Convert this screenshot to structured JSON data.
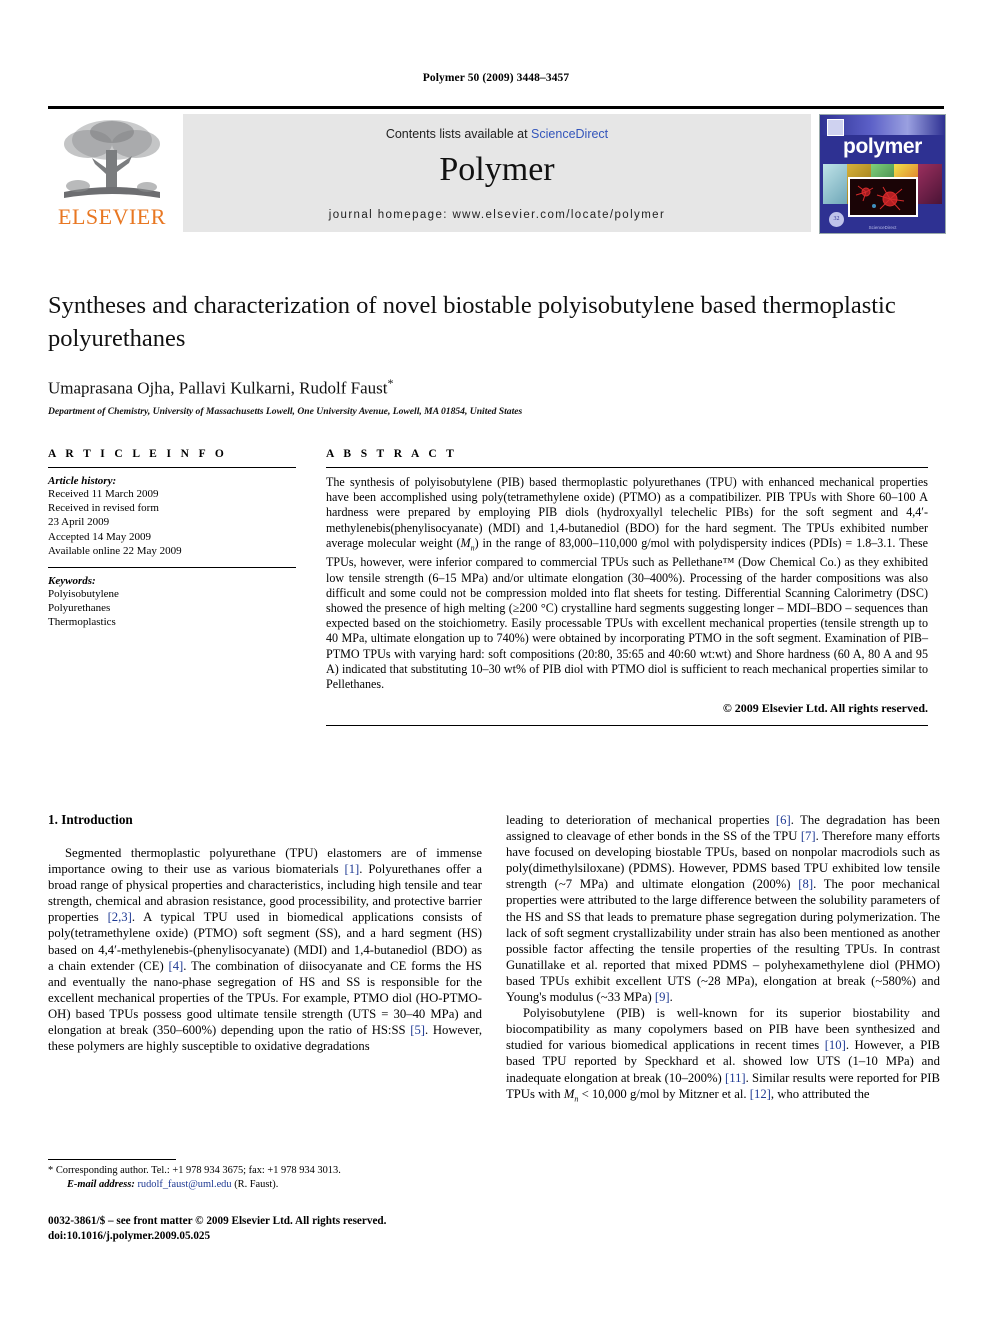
{
  "running_head": "Polymer 50 (2009) 3448–3457",
  "banner": {
    "publisher_name": "ELSEVIER",
    "contents_prefix": "Contents lists available at ",
    "contents_link": "ScienceDirect",
    "journal_name": "Polymer",
    "homepage": "journal homepage: www.elsevier.com/locate/polymer",
    "cover_title": "polymer",
    "cover_badge": "32"
  },
  "article": {
    "title": "Syntheses and characterization of novel biostable polyisobutylene based thermoplastic polyurethanes",
    "authors": "Umaprasana Ojha, Pallavi Kulkarni, Rudolf Faust",
    "corresponding_marker": "*",
    "affiliation": "Department of Chemistry, University of Massachusetts Lowell, One University Avenue, Lowell, MA 01854, United States"
  },
  "article_info": {
    "heading": "A R T I C L E   I N F O",
    "history_label": "Article history:",
    "history": [
      "Received 11 March 2009",
      "Received in revised form",
      "23 April 2009",
      "Accepted 14 May 2009",
      "Available online 22 May 2009"
    ],
    "keywords_label": "Keywords:",
    "keywords": [
      "Polyisobutylene",
      "Polyurethanes",
      "Thermoplastics"
    ]
  },
  "abstract": {
    "heading": "A B S T R A C T",
    "text": "The synthesis of polyisobutylene (PIB) based thermoplastic polyurethanes (TPU) with enhanced mechanical properties have been accomplished using poly(tetramethylene oxide) (PTMO) as a compatibilizer. PIB TPUs with Shore 60–100 A hardness were prepared by employing PIB diols (hydroxyallyl telechelic PIBs) for the soft segment and 4,4′-methylenebis(phenylisocyanate) (MDI) and 1,4-butanediol (BDO) for the hard segment. The TPUs exhibited number average molecular weight (Mn) in the range of 83,000–110,000 g/mol with polydispersity indices (PDIs) = 1.8–3.1. These TPUs, however, were inferior compared to commercial TPUs such as Pellethane™ (Dow Chemical Co.) as they exhibited low tensile strength (6–15 MPa) and/or ultimate elongation (30–400%). Processing of the harder compositions was also difficult and some could not be compression molded into flat sheets for testing. Differential Scanning Calorimetry (DSC) showed the presence of high melting (≥200 °C) crystalline hard segments suggesting longer – MDI–BDO – sequences than expected based on the stoichiometry. Easily processable TPUs with excellent mechanical properties (tensile strength up to 40 MPa, ultimate elongation up to 740%) were obtained by incorporating PTMO in the soft segment. Examination of PIB–PTMO TPUs with varying hard: soft compositions (20:80, 35:65 and 40:60 wt:wt) and Shore hardness (60 A, 80 A and 95 A) indicated that substituting 10–30 wt% of PIB diol with PTMO diol is sufficient to reach mechanical properties similar to Pellethanes.",
    "copyright": "© 2009 Elsevier Ltd. All rights reserved."
  },
  "introduction": {
    "heading": "1. Introduction",
    "left_paragraph": "Segmented thermoplastic polyurethane (TPU) elastomers are of immense importance owing to their use as various biomaterials [1]. Polyurethanes offer a broad range of physical properties and characteristics, including high tensile and tear strength, chemical and abrasion resistance, good processibility, and protective barrier properties [2,3]. A typical TPU used in biomedical applications consists of poly(tetramethylene oxide) (PTMO) soft segment (SS), and a hard segment (HS) based on 4,4′-methylenebis-(phenylisocyanate) (MDI) and 1,4-butanediol (BDO) as a chain extender (CE) [4]. The combination of diisocyanate and CE forms the HS and eventually the nano-phase segregation of HS and SS is responsible for the excellent mechanical properties of the TPUs. For example, PTMO diol (HO-PTMO-OH) based TPUs possess good ultimate tensile strength (UTS = 30–40 MPa) and elongation at break (350–600%) depending upon the ratio of HS:SS [5]. However, these polymers are highly susceptible to oxidative degradations",
    "right_paragraph_1": "leading to deterioration of mechanical properties [6]. The degradation has been assigned to cleavage of ether bonds in the SS of the TPU [7]. Therefore many efforts have focused on developing biostable TPUs, based on nonpolar macrodiols such as poly(dimethylsiloxane) (PDMS). However, PDMS based TPU exhibited low tensile strength (~7 MPa) and ultimate elongation (200%) [8]. The poor mechanical properties were attributed to the large difference between the solubility parameters of the HS and SS that leads to premature phase segregation during polymerization. The lack of soft segment crystallizability under strain has also been mentioned as another possible factor affecting the tensile properties of the resulting TPUs. In contrast Gunatillake et al. reported that mixed PDMS – polyhexamethylene diol (PHMO) based TPUs exhibit excellent UTS (~28 MPa), elongation at break (~580%) and Young's modulus (~33 MPa) [9].",
    "right_paragraph_2": "Polyisobutylene (PIB) is well-known for its superior biostability and biocompatibility as many copolymers based on PIB have been synthesized and studied for various biomedical applications in recent times [10]. However, a PIB based TPU reported by Speckhard et al. showed low UTS (1–10 MPa) and inadequate elongation at break (10–200%) [11]. Similar results were reported for PIB TPUs with Mn < 10,000 g/mol by Mitzner et al. [12], who attributed the"
  },
  "footnote": {
    "marker": "*",
    "corresponding": "Corresponding author. Tel.: +1 978 934 3675; fax: +1 978 934 3013.",
    "email_label": "E-mail address:",
    "email": "rudolf_faust@uml.edu",
    "email_suffix": "(R. Faust)."
  },
  "imprint": {
    "line1": "0032-3861/$ – see front matter © 2009 Elsevier Ltd. All rights reserved.",
    "line2": "doi:10.1016/j.polymer.2009.05.025"
  },
  "colors": {
    "elsevier_orange": "#E87722",
    "link_blue": "#3355bb",
    "reference_blue": "#1f3a93",
    "cover_blue": "#2e3192",
    "banner_gray": "#e6e6e6"
  }
}
